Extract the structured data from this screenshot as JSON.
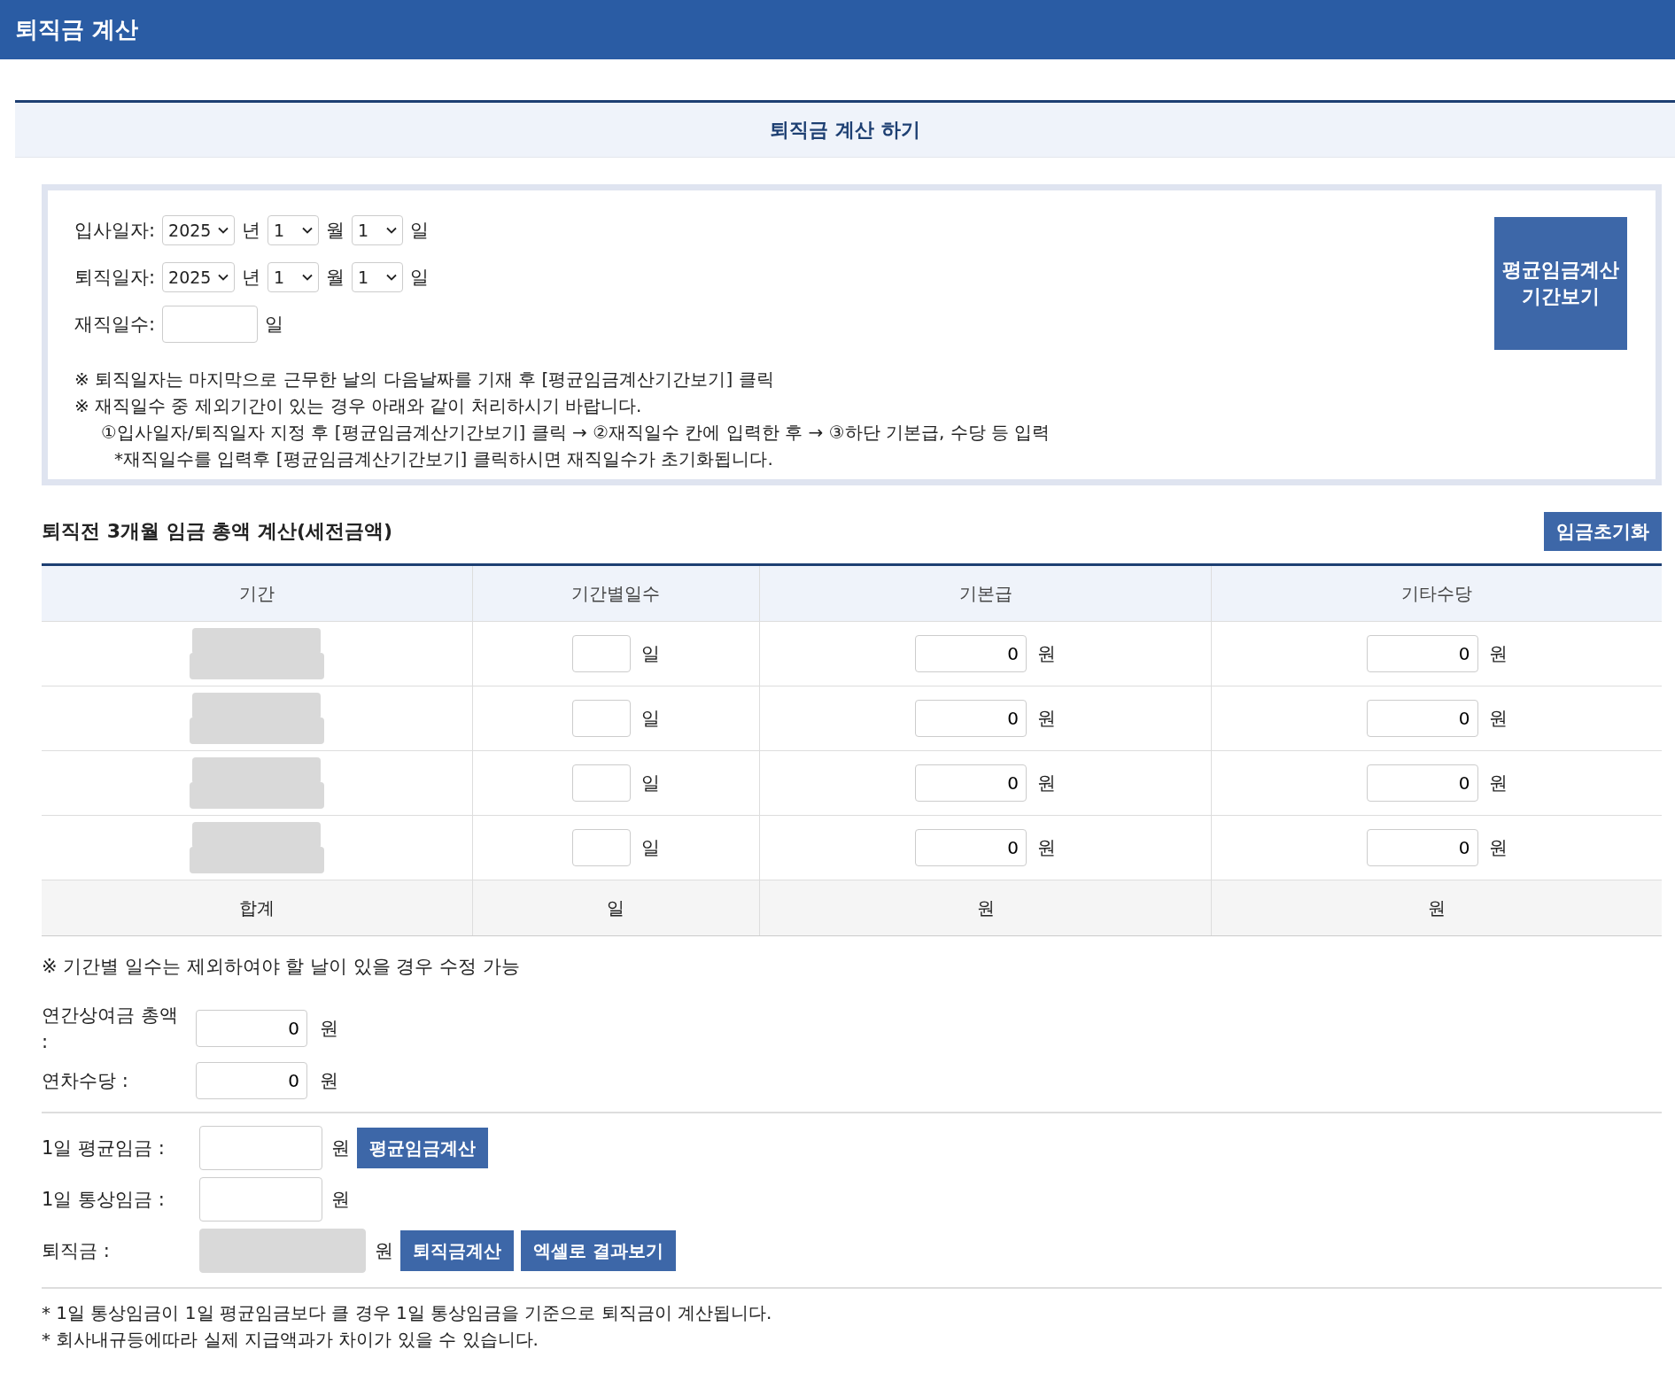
{
  "header": {
    "title": "퇴직금 계산"
  },
  "section_title": "퇴직금 계산 하기",
  "dates": [
    {
      "label": "입사일자:",
      "year": "2025",
      "year_unit": "년",
      "month": "1",
      "month_unit": "월",
      "day": "1",
      "day_unit": "일"
    },
    {
      "label": "퇴직일자:",
      "year": "2025",
      "year_unit": "년",
      "month": "1",
      "month_unit": "월",
      "day": "1",
      "day_unit": "일"
    }
  ],
  "tenure": {
    "label": "재직일수:",
    "unit": "일"
  },
  "period_button": "평균임금계산 기간보기",
  "notes": [
    {
      "kind": "main",
      "text": "※ 퇴직일자는 마지막으로 근무한 날의 다음날짜를 기재 후 [평균임금계산기간보기] 클릭"
    },
    {
      "kind": "main",
      "text": "※ 재직일수 중 제외기간이 있는 경우 아래와 같이 처리하시기 바랍니다."
    },
    {
      "kind": "step",
      "text": "①입사일자/퇴직일자 지정 후 [평균임금계산기간보기] 클릭 → ②재직일수 칸에 입력한 후 → ③하단 기본급, 수당 등 입력"
    },
    {
      "kind": "sub",
      "text": "*재직일수를 입력후 [평균임금계산기간보기] 클릭하시면 재직일수가 초기화됩니다."
    }
  ],
  "wage_section": {
    "title": "퇴직전 3개월 임금 총액 계산(세전금액)",
    "reset_button": "임금초기화"
  },
  "table": {
    "columns": [
      "기간",
      "기간별일수",
      "기본급",
      "기타수당"
    ],
    "rows": [
      {
        "period_disabled": true,
        "days_unit": "일",
        "base": "0",
        "base_unit": "원",
        "other": "0",
        "other_unit": "원"
      },
      {
        "period_disabled": true,
        "days_unit": "일",
        "base": "0",
        "base_unit": "원",
        "other": "0",
        "other_unit": "원"
      },
      {
        "period_disabled": true,
        "days_unit": "일",
        "base": "0",
        "base_unit": "원",
        "other": "0",
        "other_unit": "원"
      },
      {
        "period_disabled": true,
        "days_unit": "일",
        "base": "0",
        "base_unit": "원",
        "other": "0",
        "other_unit": "원"
      }
    ],
    "total": {
      "label": "합계",
      "days_unit": "일",
      "base_unit": "원",
      "other_unit": "원"
    }
  },
  "table_note": "※ 기간별 일수는 제외하여야 할 날이 있을 경우 수정 가능",
  "extras": [
    {
      "label": "연간상여금 총액 :",
      "value": "0",
      "unit": "원"
    },
    {
      "label": "연차수당 :",
      "value": "0",
      "unit": "원"
    }
  ],
  "results": [
    {
      "label": "1일 평균임금 :",
      "unit": "원",
      "disabled": false,
      "buttons": [
        "평균임금계산"
      ]
    },
    {
      "label": "1일 통상임금 :",
      "unit": "원",
      "disabled": false
    },
    {
      "label": "퇴직금 :",
      "unit": "원",
      "disabled": true,
      "buttons": [
        "퇴직금계산",
        "엑셀로 결과보기"
      ]
    }
  ],
  "footnotes": [
    "* 1일 통상임금이 1일 평균임금보다 클 경우 1일 통상임금을 기준으로 퇴직금이 계산됩니다.",
    "* 회사내규등에따라 실제 지급액과가 차이가 있을 수 있습니다."
  ]
}
